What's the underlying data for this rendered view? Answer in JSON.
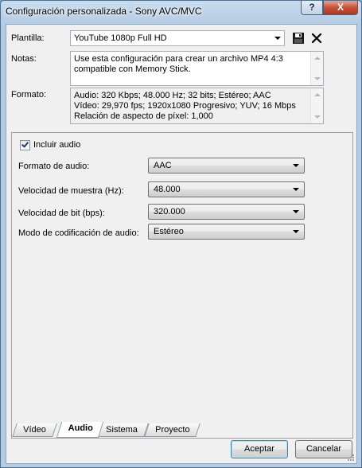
{
  "window": {
    "title": "Configuración personalizada - Sony AVC/MVC",
    "help_label": "?",
    "close_label": "X"
  },
  "template": {
    "label": "Plantilla:",
    "value": "YouTube 1080p Full HD"
  },
  "notes": {
    "label": "Notas:",
    "lines": [
      "Use esta configuración para crear un archivo MP4 4:3",
      "compatible con Memory Stick."
    ]
  },
  "format": {
    "label": "Formato:",
    "lines": [
      "Audio: 320 Kbps; 48.000 Hz; 32 bits; Estéreo; AAC",
      "Vídeo: 29,970 fps; 1920x1080 Progresivo; YUV; 16 Mbps",
      "Relación de aspecto de píxel: 1,000"
    ]
  },
  "audio": {
    "include_label": "Incluir audio",
    "include_checked": true,
    "fields": [
      {
        "label": "Formato de audio:",
        "value": "AAC"
      },
      {
        "label": "Velocidad de muestra (Hz):",
        "value": "48.000"
      },
      {
        "label": "Velocidad de bit (bps):",
        "value": "320.000"
      },
      {
        "label": "Modo de codificación de audio:",
        "value": "Estéreo"
      }
    ]
  },
  "tabs": [
    {
      "label": "Vídeo",
      "active": false
    },
    {
      "label": "Audio",
      "active": true
    },
    {
      "label": "Sistema",
      "active": false
    },
    {
      "label": "Proyecto",
      "active": false
    }
  ],
  "buttons": {
    "accept": "Aceptar",
    "cancel": "Cancelar"
  },
  "icons": {
    "save": "floppy-disk-icon",
    "delete": "delete-x-icon"
  }
}
